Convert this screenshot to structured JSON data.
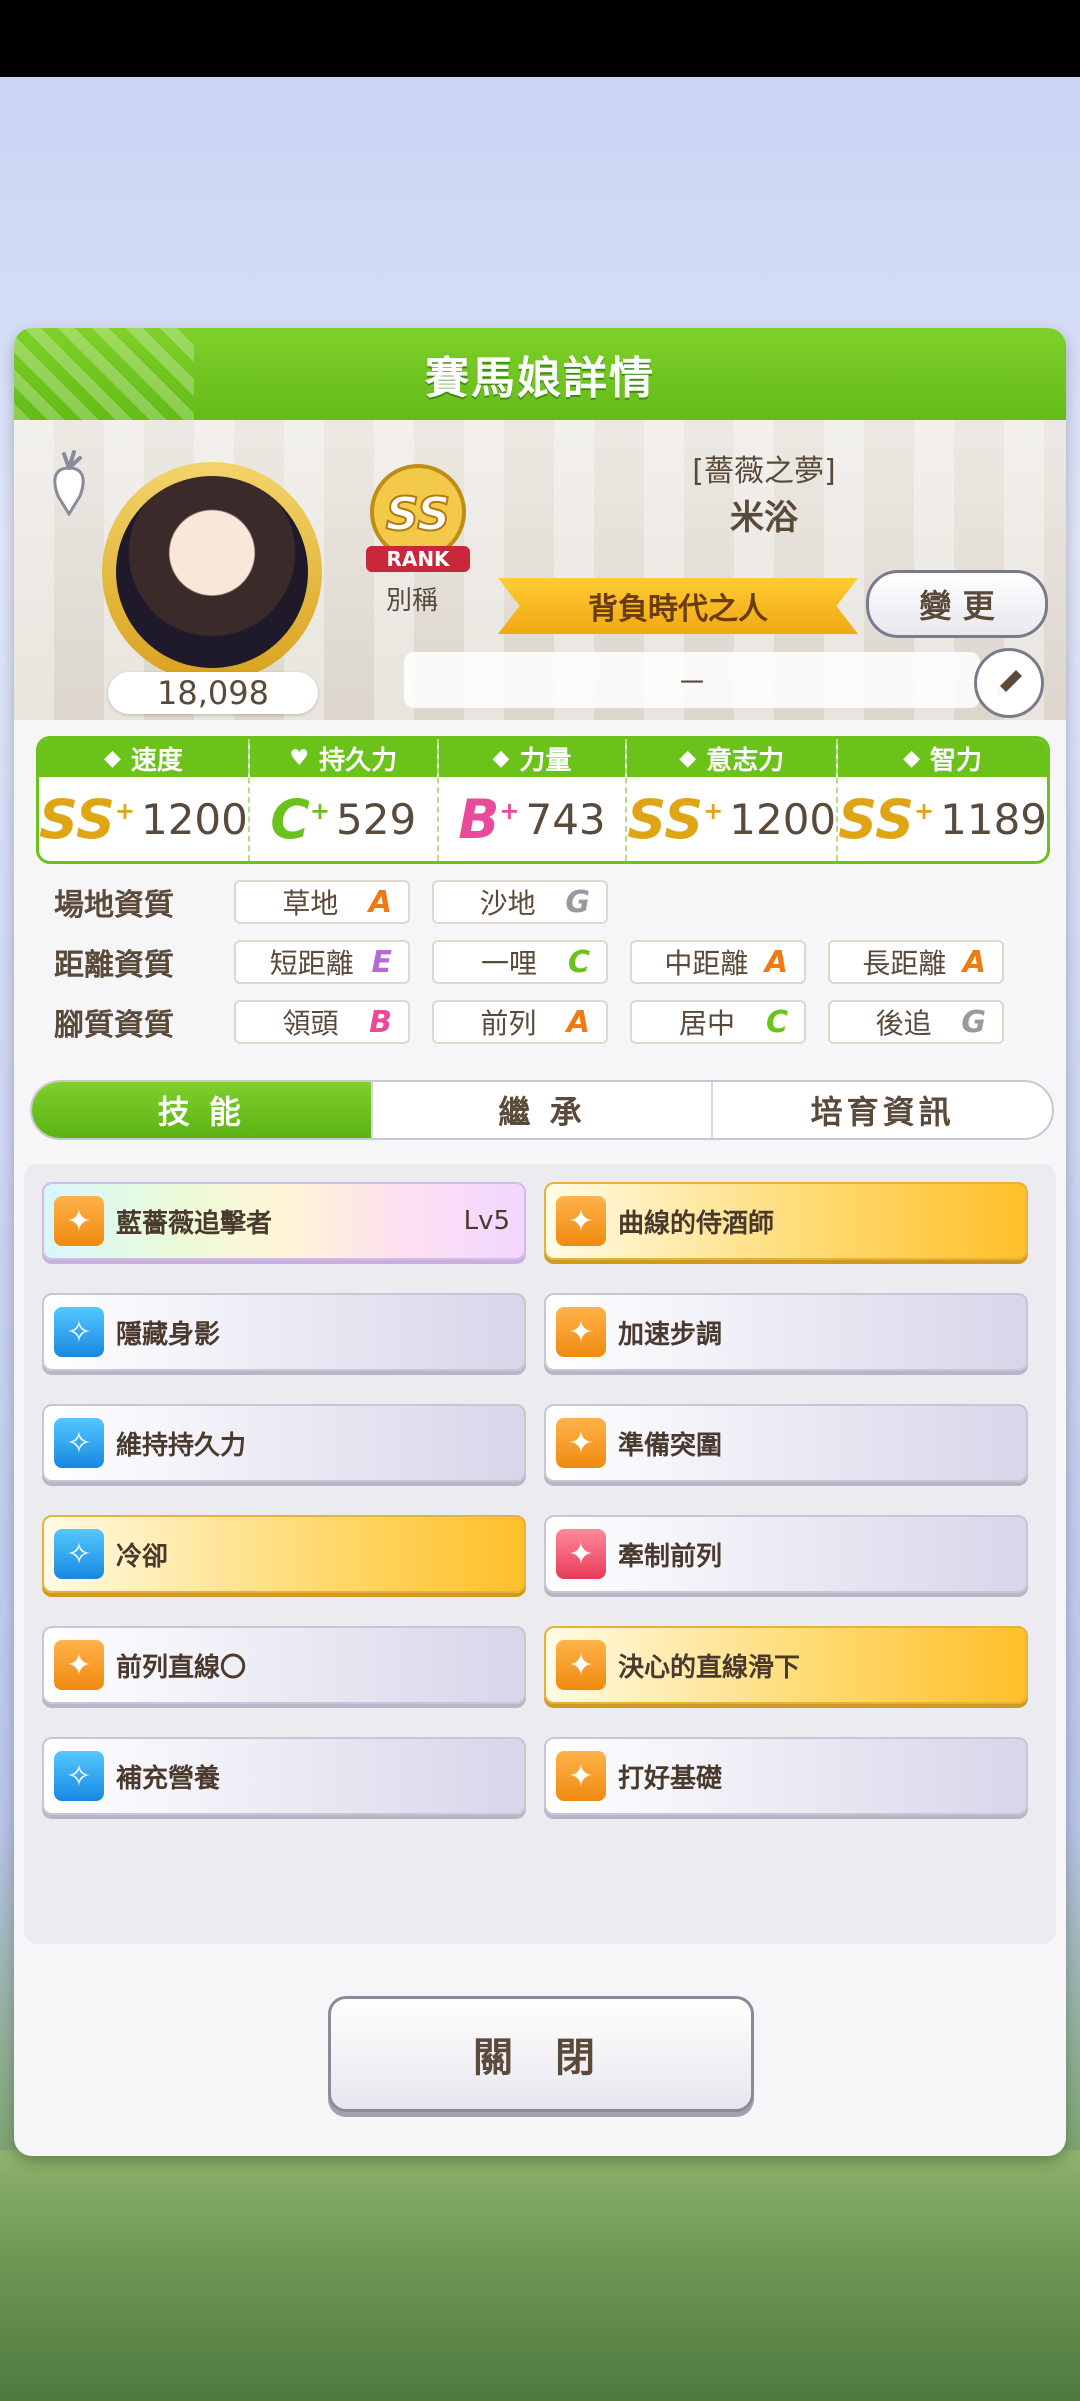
{
  "dialog": {
    "title": "賽馬娘詳情"
  },
  "profile": {
    "fans": "18,098",
    "rank_label": "RANK",
    "rank_grade": "SS",
    "alias_label": "別稱",
    "outfit": "[薔薇之夢]",
    "name": "米浴",
    "title": "背負時代之人",
    "change_label": "變 更",
    "comment": "－"
  },
  "stats": [
    {
      "label": "速度",
      "icon": "shoe-icon",
      "grade": "SS",
      "plus": "+",
      "value": "1200",
      "color": "#e0a514"
    },
    {
      "label": "持久力",
      "icon": "heart-icon",
      "grade": "C",
      "plus": "+",
      "value": "529",
      "color": "#6bc11d"
    },
    {
      "label": "力量",
      "icon": "muscle-icon",
      "grade": "B",
      "plus": "+",
      "value": "743",
      "color": "#e84b9a"
    },
    {
      "label": "意志力",
      "icon": "flame-icon",
      "grade": "SS",
      "plus": "+",
      "value": "1200",
      "color": "#e0a514"
    },
    {
      "label": "智力",
      "icon": "graduation-cap-icon",
      "grade": "SS",
      "plus": "+",
      "value": "1189",
      "color": "#e0a514"
    }
  ],
  "aptitudes": {
    "track": {
      "label": "場地資質",
      "items": [
        {
          "name": "草地",
          "grade": "A"
        },
        {
          "name": "沙地",
          "grade": "G"
        }
      ]
    },
    "distance": {
      "label": "距離資質",
      "items": [
        {
          "name": "短距離",
          "grade": "E"
        },
        {
          "name": "一哩",
          "grade": "C"
        },
        {
          "name": "中距離",
          "grade": "A"
        },
        {
          "name": "長距離",
          "grade": "A"
        }
      ]
    },
    "style": {
      "label": "腳質資質",
      "items": [
        {
          "name": "領頭",
          "grade": "B"
        },
        {
          "name": "前列",
          "grade": "A"
        },
        {
          "name": "居中",
          "grade": "C"
        },
        {
          "name": "後追",
          "grade": "G"
        }
      ]
    }
  },
  "tabs": [
    {
      "label": "技 能",
      "active": true
    },
    {
      "label": "繼 承",
      "active": false
    },
    {
      "label": "培育資訊",
      "active": false
    }
  ],
  "skills": [
    {
      "name": "藍薔薇追擊者",
      "level": "Lv5",
      "style": "rainbow",
      "icon": "ic-orange"
    },
    {
      "name": "曲線的侍酒師",
      "level": "",
      "style": "gold",
      "icon": "ic-orange"
    },
    {
      "name": "隱藏身影",
      "level": "",
      "style": "plain",
      "icon": "ic-blue"
    },
    {
      "name": "加速步調",
      "level": "",
      "style": "plain",
      "icon": "ic-orange"
    },
    {
      "name": "維持持久力",
      "level": "",
      "style": "plain",
      "icon": "ic-blue"
    },
    {
      "name": "準備突圍",
      "level": "",
      "style": "plain",
      "icon": "ic-orange"
    },
    {
      "name": "冷卻",
      "level": "",
      "style": "gold",
      "icon": "ic-blue"
    },
    {
      "name": "牽制前列",
      "level": "",
      "style": "plain",
      "icon": "ic-red"
    },
    {
      "name": "前列直線〇",
      "level": "",
      "style": "plain",
      "icon": "ic-orange"
    },
    {
      "name": "決心的直線滑下",
      "level": "",
      "style": "gold",
      "icon": "ic-orange"
    },
    {
      "name": "補充營養",
      "level": "",
      "style": "plain",
      "icon": "ic-blue"
    },
    {
      "name": "打好基礎",
      "level": "",
      "style": "plain",
      "icon": "ic-orange"
    }
  ],
  "footer": {
    "close_label": "關 閉"
  }
}
